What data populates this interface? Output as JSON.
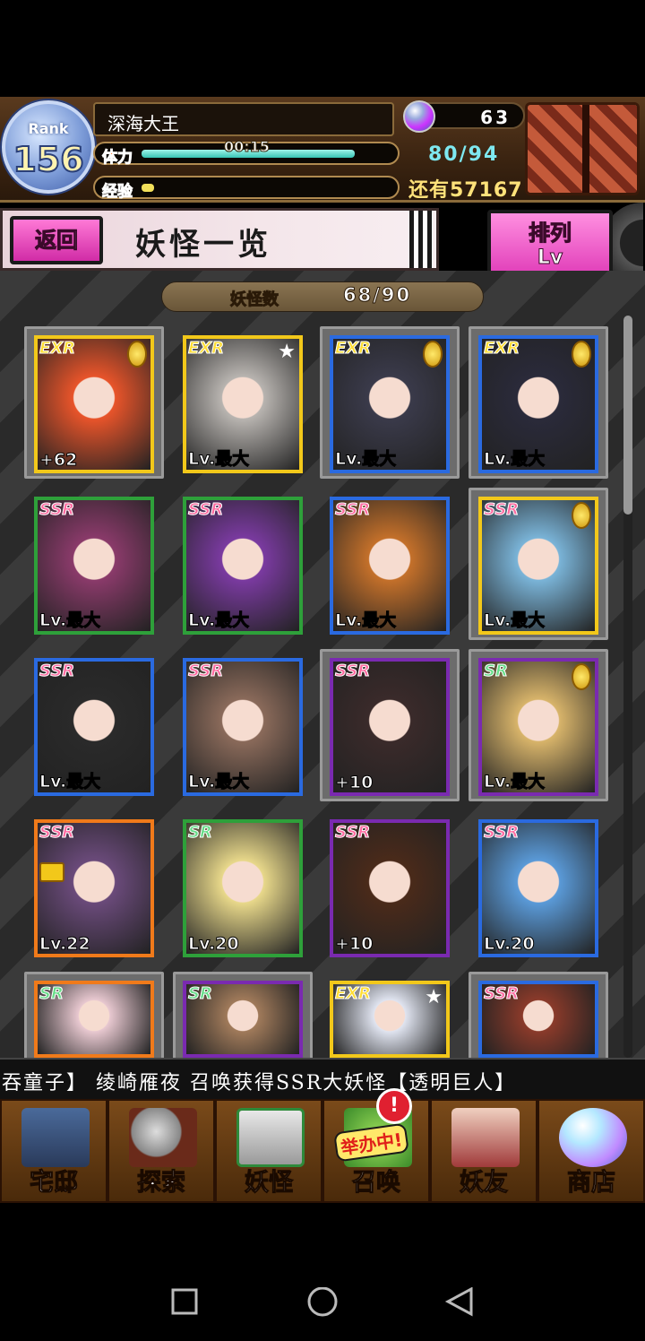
{
  "player": {
    "rank_label": "Rank",
    "rank": "156",
    "name": "深海大王",
    "stamina_label": "体力",
    "stamina_timer": "00:15",
    "stamina_value": "80/94",
    "stamina_fraction": 0.85,
    "exp_label": "经验",
    "exp_fraction": 0.05,
    "gems": "63",
    "remaining": "还有57167"
  },
  "title_bar": {
    "back": "返回",
    "title": "妖怪一览",
    "sort_top": "排列",
    "sort_bottom": "Lv"
  },
  "count": {
    "label": "妖怪数",
    "value": "68/90"
  },
  "cards": [
    {
      "rarity": "EXR",
      "level": "+62",
      "medal": "gold",
      "frame": "gold",
      "art": "#e8542a",
      "selected": true
    },
    {
      "rarity": "EXR",
      "level": "Lv.最大",
      "medal": "star",
      "frame": "gold",
      "art": "#b8b4b0",
      "selected": false
    },
    {
      "rarity": "EXR",
      "level": "Lv.最大",
      "medal": "gold",
      "frame": "blue",
      "art": "#3a3a4a",
      "selected": true
    },
    {
      "rarity": "EXR",
      "level": "Lv.最大",
      "medal": "gold",
      "frame": "blue",
      "art": "#2a2a3a",
      "selected": true
    },
    {
      "rarity": "SSR",
      "level": "Lv.最大",
      "medal": "",
      "frame": "green",
      "art": "#8a3a6a",
      "selected": false
    },
    {
      "rarity": "SSR",
      "level": "Lv.最大",
      "medal": "",
      "frame": "green",
      "art": "#7a3aa0",
      "selected": false
    },
    {
      "rarity": "SSR",
      "level": "Lv.最大",
      "medal": "",
      "frame": "blue",
      "art": "#c4702a",
      "selected": false
    },
    {
      "rarity": "SSR",
      "level": "Lv.最大",
      "medal": "gold",
      "frame": "gold",
      "art": "#7ab4d8",
      "selected": true
    },
    {
      "rarity": "SSR",
      "level": "Lv.最大",
      "medal": "",
      "frame": "blue",
      "art": "#2a2a2a",
      "selected": false
    },
    {
      "rarity": "SSR",
      "level": "Lv.最大",
      "medal": "",
      "frame": "blue",
      "art": "#8a6a5a",
      "selected": false
    },
    {
      "rarity": "SSR",
      "level": "+10",
      "medal": "",
      "frame": "purple",
      "art": "#3a2a2a",
      "selected": true
    },
    {
      "rarity": "SR",
      "level": "Lv.最大",
      "medal": "gold",
      "frame": "purple",
      "art": "#d8b46a",
      "selected": true
    },
    {
      "rarity": "SSR",
      "level": "Lv.22",
      "medal": "lock",
      "frame": "orange",
      "art": "#6a4a7a",
      "selected": false
    },
    {
      "rarity": "SR",
      "level": "Lv.20",
      "medal": "",
      "frame": "green",
      "art": "#e8d88a",
      "selected": false
    },
    {
      "rarity": "SSR",
      "level": "+10",
      "medal": "",
      "frame": "purple",
      "art": "#4a2a1a",
      "selected": false
    },
    {
      "rarity": "SSR",
      "level": "Lv.20",
      "medal": "",
      "frame": "blue",
      "art": "#5a9ad8",
      "selected": false
    },
    {
      "rarity": "SR",
      "level": "",
      "medal": "",
      "frame": "orange",
      "art": "#e8c8d0",
      "selected": true
    },
    {
      "rarity": "SR",
      "level": "",
      "medal": "",
      "frame": "purple",
      "art": "#a07a5a",
      "selected": true
    },
    {
      "rarity": "EXR",
      "level": "",
      "medal": "star",
      "frame": "gold",
      "art": "#e0e4f0",
      "selected": false
    },
    {
      "rarity": "SSR",
      "level": "",
      "medal": "",
      "frame": "blue",
      "art": "#8a3a2a",
      "selected": true
    }
  ],
  "ticker": "吞童子】  绫崎雁夜 召唤获得SSR大妖怪【透明巨人】",
  "nav": {
    "home": "宅邸",
    "explore": "探索",
    "yokai": "妖怪",
    "summon": "召唤",
    "summon_badge": "举办中!",
    "summon_alert": "!",
    "friends": "妖友",
    "shop": "商店"
  },
  "colors": {
    "exr": "#ffdd33",
    "ssr": "#ff6aa0",
    "sr": "#66dd88"
  }
}
